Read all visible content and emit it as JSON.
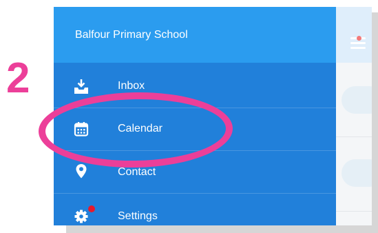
{
  "annotation": {
    "step_number": "2"
  },
  "drawer": {
    "school_name": "Balfour Primary School",
    "items": [
      {
        "label": "Inbox",
        "icon": "inbox-download-icon"
      },
      {
        "label": "Calendar",
        "icon": "calendar-icon"
      },
      {
        "label": "Contact",
        "icon": "location-pin-icon"
      },
      {
        "label": "Settings",
        "icon": "gear-icon",
        "badge": true
      }
    ]
  },
  "colors": {
    "drawer_header": "#2b9cef",
    "drawer_body": "#2180da",
    "highlight": "#ec3f99",
    "badge": "#e8192c"
  }
}
